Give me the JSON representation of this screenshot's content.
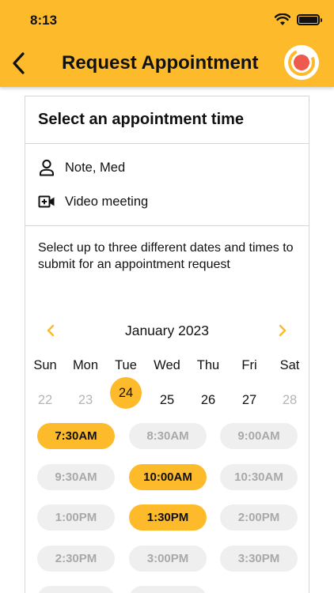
{
  "status": {
    "time": "8:13"
  },
  "header": {
    "title": "Request Appointment"
  },
  "card": {
    "title": "Select an appointment time",
    "provider": "Note, Med",
    "meeting_type": "Video meeting",
    "instructions": "Select up to three different dates and times to submit for an appointment request"
  },
  "calendar": {
    "month": "January 2023",
    "weekdays": [
      "Sun",
      "Mon",
      "Tue",
      "Wed",
      "Thu",
      "Fri",
      "Sat"
    ],
    "days": [
      "22",
      "23",
      "24",
      "25",
      "26",
      "27",
      "28"
    ],
    "muted_days": [
      "22",
      "23",
      "28"
    ],
    "selected_day": "24"
  },
  "time_slots": [
    [
      "7:30AM",
      "8:30AM",
      "9:00AM"
    ],
    [
      "9:30AM",
      "10:00AM",
      "10:30AM"
    ],
    [
      "1:00PM",
      "1:30PM",
      "2:00PM"
    ],
    [
      "2:30PM",
      "3:00PM",
      "3:30PM"
    ]
  ],
  "selected_slots": [
    "7:30AM",
    "10:00AM",
    "1:30PM"
  ],
  "colors": {
    "accent": "#FDBB2C",
    "slot_bg": "#EFEFEF",
    "muted_text": "#A9A9A9",
    "logo_dot": "#EF5A4E"
  }
}
